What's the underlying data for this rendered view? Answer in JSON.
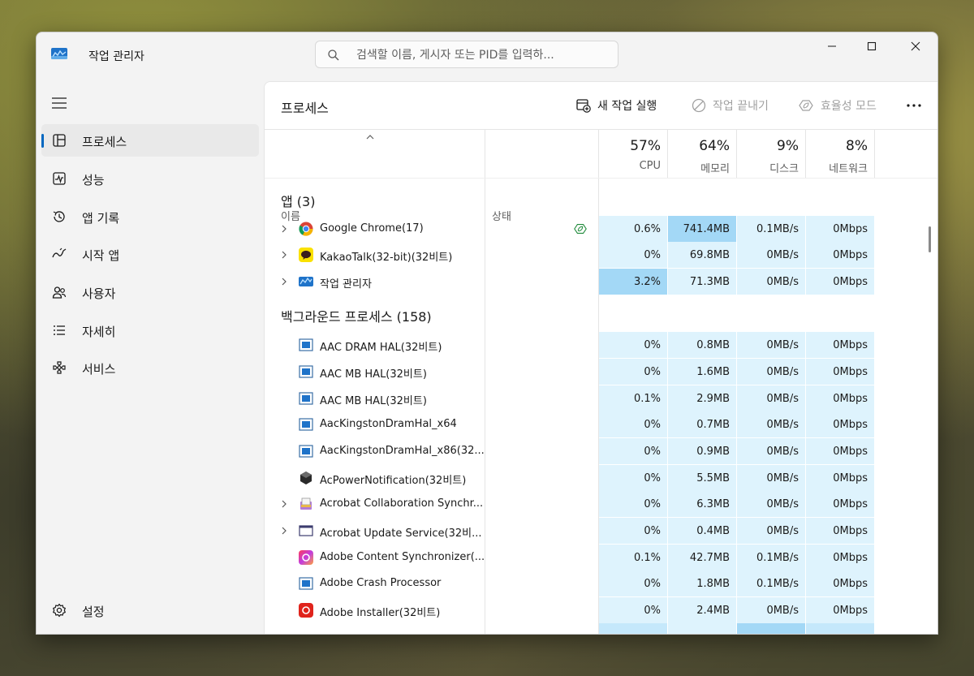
{
  "window": {
    "title": "작업 관리자",
    "search_placeholder": "검색할 이름, 게시자 또는 PID를 입력하..."
  },
  "nav": {
    "items": [
      {
        "label": "프로세스",
        "icon": "processes-icon",
        "selected": true
      },
      {
        "label": "성능",
        "icon": "performance-icon"
      },
      {
        "label": "앱 기록",
        "icon": "app-history-icon"
      },
      {
        "label": "시작 앱",
        "icon": "startup-apps-icon"
      },
      {
        "label": "사용자",
        "icon": "users-icon"
      },
      {
        "label": "자세히",
        "icon": "details-icon"
      },
      {
        "label": "서비스",
        "icon": "services-icon"
      }
    ],
    "settings_label": "설정"
  },
  "page": {
    "title": "프로세스",
    "toolbar": {
      "run_task": "새 작업 실행",
      "end_task": "작업 끝내기",
      "efficiency_mode": "효율성 모드",
      "more": "..."
    }
  },
  "columns": {
    "name": "이름",
    "status": "상태",
    "cpu": {
      "percent": "57%",
      "label": "CPU"
    },
    "memory": {
      "percent": "64%",
      "label": "메모리"
    },
    "disk": {
      "percent": "9%",
      "label": "디스크"
    },
    "network": {
      "percent": "8%",
      "label": "네트워크"
    }
  },
  "groups": {
    "apps": {
      "title": "앱 (3)",
      "rows": [
        {
          "name": "Google Chrome(17)",
          "icon": "chrome-icon",
          "expandable": true,
          "efficiency_leaf": true,
          "cpu": "0.6%",
          "mem": "741.4MB",
          "disk": "0.1MB/s",
          "net": "0Mbps"
        },
        {
          "name": "KakaoTalk(32-bit)(32비트)",
          "icon": "kakaotalk-icon",
          "expandable": true,
          "cpu": "0%",
          "mem": "69.8MB",
          "disk": "0MB/s",
          "net": "0Mbps"
        },
        {
          "name": "작업 관리자",
          "icon": "task-manager-icon",
          "expandable": true,
          "cpu": "3.2%",
          "mem": "71.3MB",
          "disk": "0MB/s",
          "net": "0Mbps"
        }
      ]
    },
    "background": {
      "title": "백그라운드 프로세스 (158)",
      "rows": [
        {
          "name": "AAC DRAM HAL(32비트)",
          "icon": "app-window-icon",
          "cpu": "0%",
          "mem": "0.8MB",
          "disk": "0MB/s",
          "net": "0Mbps"
        },
        {
          "name": "AAC MB HAL(32비트)",
          "icon": "app-window-icon",
          "cpu": "0%",
          "mem": "1.6MB",
          "disk": "0MB/s",
          "net": "0Mbps"
        },
        {
          "name": "AAC MB HAL(32비트)",
          "icon": "app-window-icon",
          "cpu": "0.1%",
          "mem": "2.9MB",
          "disk": "0MB/s",
          "net": "0Mbps"
        },
        {
          "name": "AacKingstonDramHal_x64",
          "icon": "app-window-icon",
          "cpu": "0%",
          "mem": "0.7MB",
          "disk": "0MB/s",
          "net": "0Mbps"
        },
        {
          "name": "AacKingstonDramHal_x86(32...",
          "icon": "app-window-icon",
          "cpu": "0%",
          "mem": "0.9MB",
          "disk": "0MB/s",
          "net": "0Mbps"
        },
        {
          "name": "AcPowerNotification(32비트)",
          "icon": "power-notification-icon",
          "cpu": "0%",
          "mem": "5.5MB",
          "disk": "0MB/s",
          "net": "0Mbps"
        },
        {
          "name": "Acrobat Collaboration Synchr...",
          "icon": "acrobat-collab-icon",
          "expandable": true,
          "cpu": "0%",
          "mem": "6.3MB",
          "disk": "0MB/s",
          "net": "0Mbps"
        },
        {
          "name": "Acrobat Update Service(32비...",
          "icon": "blank-window-icon",
          "expandable": true,
          "cpu": "0%",
          "mem": "0.4MB",
          "disk": "0MB/s",
          "net": "0Mbps"
        },
        {
          "name": "Adobe Content Synchronizer(...",
          "icon": "adobe-cc-icon",
          "cpu": "0.1%",
          "mem": "42.7MB",
          "disk": "0.1MB/s",
          "net": "0Mbps"
        },
        {
          "name": "Adobe Crash Processor",
          "icon": "app-window-icon",
          "cpu": "0%",
          "mem": "1.8MB",
          "disk": "0.1MB/s",
          "net": "0Mbps"
        },
        {
          "name": "Adobe Installer(32비트)",
          "icon": "adobe-installer-icon",
          "cpu": "0%",
          "mem": "2.4MB",
          "disk": "0MB/s",
          "net": "0Mbps"
        }
      ]
    }
  },
  "colors": {
    "heat_low": "#def3fd",
    "heat_mid": "#c5e8fb",
    "heat_high": "#a3d8f6",
    "accent": "#0067c0"
  }
}
